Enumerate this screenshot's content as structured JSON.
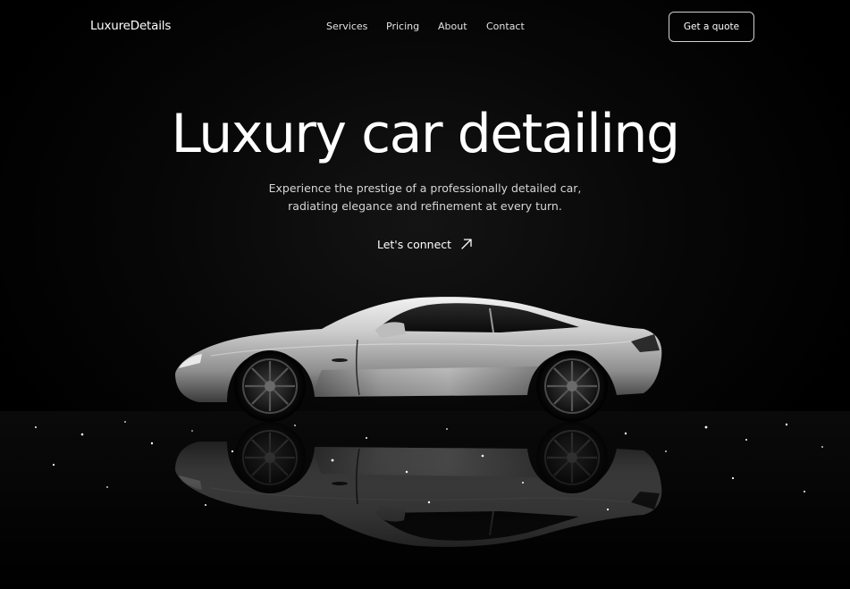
{
  "header": {
    "brand": "LuxureDetails",
    "nav": [
      "Services",
      "Pricing",
      "About",
      "Contact"
    ],
    "cta_label": "Get a quote"
  },
  "hero": {
    "title": "Luxury car detailing",
    "subtitle_line1": "Experience the prestige of a professionally detailed car,",
    "subtitle_line2": "radiating elegance and refinement at every turn.",
    "link_label": "Let's connect",
    "link_icon": "arrow-up-right-icon"
  },
  "image": {
    "subject": "silver sports car on wet reflective floor",
    "palette": {
      "background": "#000000",
      "text": "#ffffff",
      "subtext": "#d6d6d6",
      "button_border": "#cfcfcf"
    }
  }
}
